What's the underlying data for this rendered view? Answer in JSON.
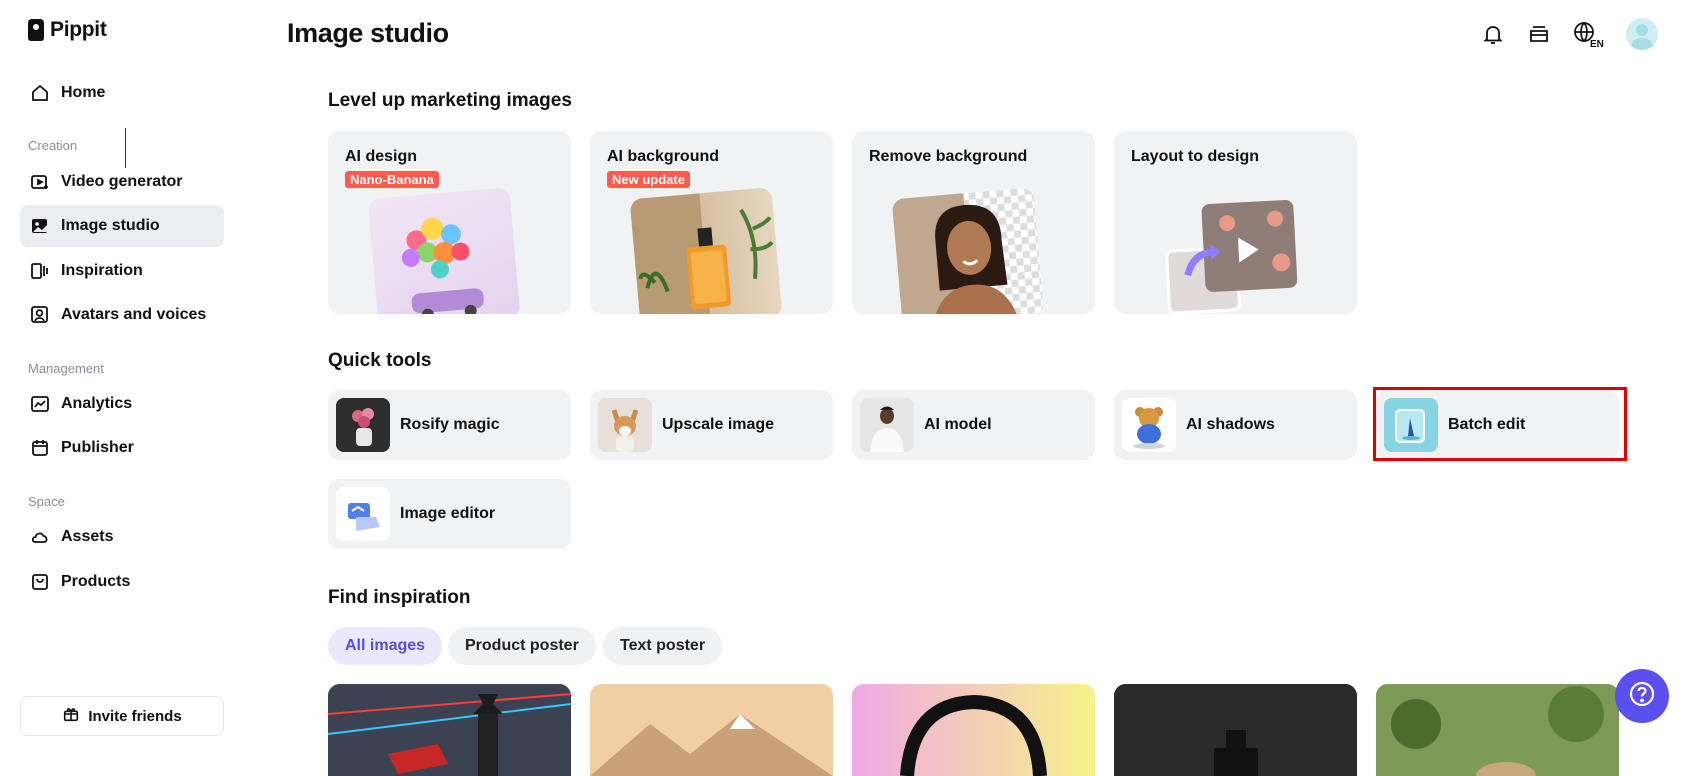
{
  "app": {
    "logo_text": "Pippit",
    "page_title": "Image studio"
  },
  "sidebar": {
    "items": [
      {
        "label": "Home",
        "icon": "home-icon"
      },
      {
        "label": "Video generator",
        "icon": "video-generator-icon"
      },
      {
        "label": "Image studio",
        "icon": "image-studio-icon",
        "active": true
      },
      {
        "label": "Inspiration",
        "icon": "inspiration-icon"
      },
      {
        "label": "Avatars and voices",
        "icon": "avatar-icon"
      },
      {
        "label": "Analytics",
        "icon": "analytics-icon"
      },
      {
        "label": "Publisher",
        "icon": "calendar-icon"
      },
      {
        "label": "Assets",
        "icon": "cloud-icon"
      },
      {
        "label": "Products",
        "icon": "product-icon"
      }
    ],
    "sections": {
      "creation": "Creation",
      "management": "Management",
      "space": "Space"
    },
    "invite_label": "Invite friends"
  },
  "header": {
    "icons": [
      "bell-icon",
      "subscription-icon",
      "language-icon",
      "avatar"
    ],
    "language_code": "EN"
  },
  "marketing": {
    "title": "Level up marketing images",
    "cards": [
      {
        "title": "AI design",
        "badge": "Nano-Banana"
      },
      {
        "title": "AI background",
        "badge": "New update"
      },
      {
        "title": "Remove background"
      },
      {
        "title": "Layout to design"
      }
    ]
  },
  "quick_tools": {
    "title": "Quick tools",
    "items": [
      {
        "label": "Rosify magic"
      },
      {
        "label": "Upscale image"
      },
      {
        "label": "AI model"
      },
      {
        "label": "AI shadows"
      },
      {
        "label": "Batch edit",
        "highlighted": true
      },
      {
        "label": "Image editor"
      }
    ]
  },
  "inspiration": {
    "title": "Find inspiration",
    "filters": [
      {
        "label": "All images",
        "active": true
      },
      {
        "label": "Product poster"
      },
      {
        "label": "Text poster"
      }
    ]
  },
  "colors": {
    "accent": "#5c4ff0",
    "badge": "#ff5a4e",
    "highlight": "#e00000",
    "card_bg": "#f1f2f4"
  }
}
